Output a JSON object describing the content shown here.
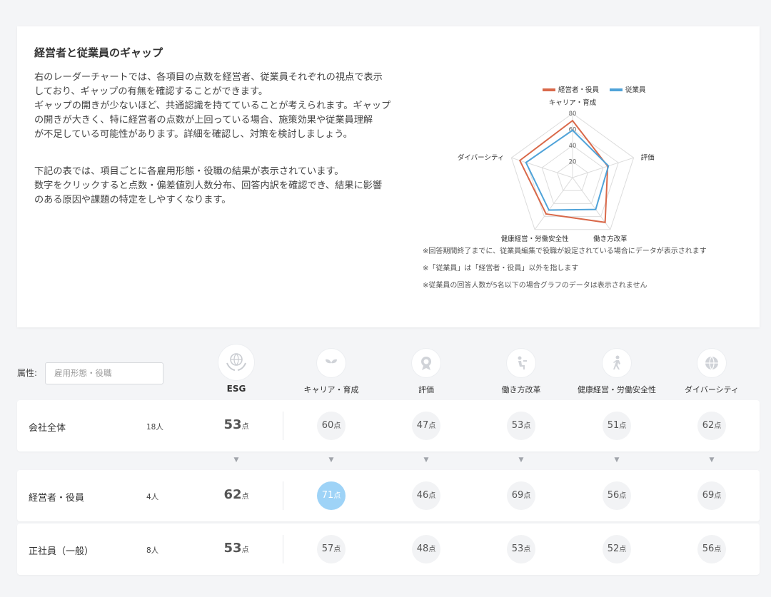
{
  "gap_section": {
    "title": "経営者と従業員のギャップ",
    "paragraph1": [
      "右のレーダーチャートでは、各項目の点数を経営者、従業員それぞれの視点で表示",
      "しており、ギャップの有無を確認することができます。",
      "ギャップの開きが少ないほど、共通認識を持てていることが考えられます。ギャップ",
      "の開きが大きく、特に経営者の点数が上回っている場合、施策効果や従業員理解",
      "が不足している可能性があります。詳細を確認し、対策を検討しましょう。"
    ],
    "paragraph2": [
      "下記の表では、項目ごとに各雇用形態・役職の結果が表示されています。",
      "数字をクリックすると点数・偏差値別人数分布、回答内訳を確認でき、結果に影響",
      "のある原因や課題の特定をしやすくなります。"
    ],
    "notes": [
      "※回答期間終了までに、従業員編集で役職が設定されている場合にデータが表示されます",
      "※「従業員」は「経営者・役員」以外を指します",
      "※従業員の回答人数が5名以下の場合グラフのデータは表示されません"
    ]
  },
  "chart_data": {
    "type": "radar",
    "axes": [
      "キャリア・育成",
      "評価",
      "働き方改革",
      "健康経営・労働安全性",
      "ダイバーシティ"
    ],
    "rlim": [
      0,
      80
    ],
    "ticks": [
      20,
      40,
      60,
      80
    ],
    "legend_position": "top",
    "series": [
      {
        "name": "経営者・役員",
        "color": "#d9694a",
        "values": [
          71,
          46,
          69,
          56,
          69
        ]
      },
      {
        "name": "従業員",
        "color": "#4fa3d9",
        "values": [
          59,
          47,
          49,
          50,
          61
        ]
      }
    ]
  },
  "filter": {
    "label": "属性:",
    "placeholder": "雇用形態・役職"
  },
  "columns": {
    "esg": "ESG",
    "categories": [
      {
        "label": "キャリア・育成",
        "icon": "seedling-icon"
      },
      {
        "label": "評価",
        "icon": "award-icon"
      },
      {
        "label": "働き方改革",
        "icon": "desk-worker-icon"
      },
      {
        "label": "健康経営・労働安全性",
        "icon": "walking-person-icon"
      },
      {
        "label": "ダイバーシティ",
        "icon": "globe-people-icon"
      }
    ]
  },
  "score_unit": "点",
  "rows": [
    {
      "name": "会社全体",
      "count": "18人",
      "esg": "53",
      "scores": [
        "60",
        "47",
        "53",
        "51",
        "62"
      ]
    },
    {
      "name": "経営者・役員",
      "count": "4人",
      "esg": "62",
      "scores": [
        "71",
        "46",
        "69",
        "56",
        "69"
      ]
    },
    {
      "name": "正社員（一般）",
      "count": "8人",
      "esg": "53",
      "scores": [
        "57",
        "48",
        "53",
        "52",
        "56"
      ]
    }
  ],
  "highlight_color": "#9ed3f7"
}
